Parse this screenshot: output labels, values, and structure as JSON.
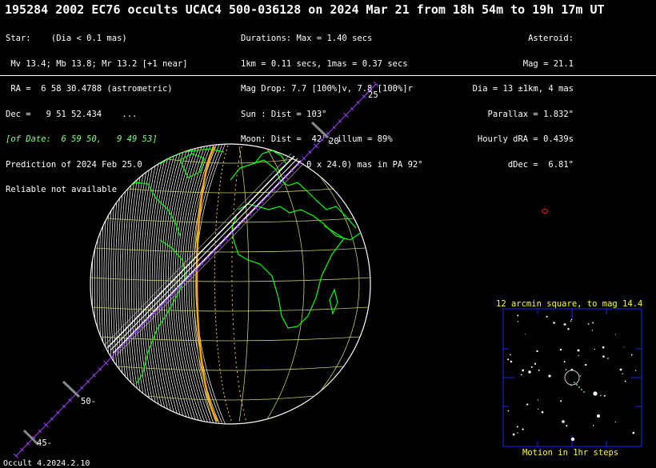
{
  "title": "195284 2002 EC76 occults UCAC4 500-036128 on 2024 Mar 21 from 18h 54m to 19h 17m UT",
  "star": {
    "line1": "Star:    (Dia < 0.1 mas)",
    "line2": " Mv 13.4; Mb 13.8; Mr 13.2 [+1 near]",
    "line3": " RA =  6 58 30.4788 (astrometric)",
    "line4": "Dec =   9 51 52.434    ...",
    "line5": "[of Date:  6 59 50,   9 49 53]",
    "line6": "Prediction of 2024 Feb 25.0",
    "line7": "Reliable not available"
  },
  "event": {
    "line1": "Durations: Max = 1.40 secs",
    "line2": "1km = 0.11 secs, 1mas = 0.37 secs",
    "line3": "Mag Drop: 7.7 [100%]v, 7.8 [100%]r",
    "line4": "Sun : Dist = 103°",
    "line5": "Moon: Dist =  42°, illum = 89%",
    "line6": "1σ Err: ±(39.0 x 24.0) mas in PA 92°"
  },
  "asteroid": {
    "line1": "Asteroid:",
    "line2": "Mag = 21.1",
    "line3": "Dia = 13 ±1km, 4 mas",
    "line4": "Parallax = 1.832\"",
    "line5": "Hourly dRA = 0.439s",
    "line6": "dDec =  6.81\""
  },
  "track_labels": {
    "t25": "25",
    "t20": "20",
    "t50": "50-",
    "t45": "45-"
  },
  "finder": {
    "title": "12 arcmin square, to mag 14.4",
    "caption": "Motion in 1hr steps"
  },
  "footer": "Occult 4.2024.2.10",
  "colors": {
    "background": "#000000",
    "coast": "#00ff00",
    "grid": "#c8c864",
    "terminator": "#ffa500",
    "path": "#ffffff",
    "track": "#a040ff",
    "finder_box": "#0000ff",
    "finder_text": "#ffff00"
  }
}
